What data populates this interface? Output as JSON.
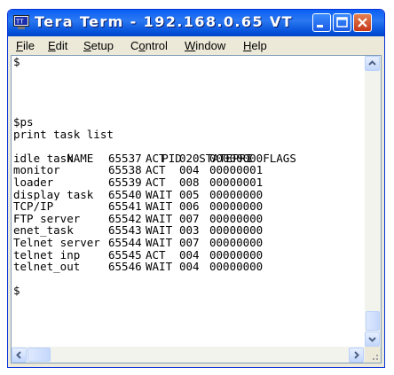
{
  "window": {
    "title": "Tera Term - 192.168.0.65 VT",
    "colors": {
      "titlebar": "#0a5ff5",
      "close_button": "#c6391a"
    }
  },
  "menu": [
    {
      "label": "File",
      "accel": "F"
    },
    {
      "label": "Edit",
      "accel": "E"
    },
    {
      "label": "Setup",
      "accel": "S"
    },
    {
      "label": "Control",
      "accel": "o"
    },
    {
      "label": "Window",
      "accel": "W"
    },
    {
      "label": "Help",
      "accel": "H"
    }
  ],
  "terminal": {
    "prompt_top": "$",
    "command": "$ps",
    "caption": "print task list",
    "headers": [
      "NAME",
      "PID",
      "STATE",
      "PRI",
      "FLAGS"
    ],
    "rows": [
      [
        "idle_task",
        "65537",
        "ACT",
        "020",
        "00000000"
      ],
      [
        "monitor",
        "65538",
        "ACT",
        "004",
        "00000001"
      ],
      [
        "loader",
        "65539",
        "ACT",
        "008",
        "00000001"
      ],
      [
        "display_task",
        "65540",
        "WAIT",
        "005",
        "00000000"
      ],
      [
        "TCP/IP",
        "65541",
        "WAIT",
        "006",
        "00000000"
      ],
      [
        "FTP server",
        "65542",
        "WAIT",
        "007",
        "00000000"
      ],
      [
        "enet_task",
        "65543",
        "WAIT",
        "003",
        "00000000"
      ],
      [
        "Telnet server",
        "65544",
        "WAIT",
        "007",
        "00000000"
      ],
      [
        "telnet_inp",
        "65545",
        "ACT",
        "004",
        "00000000"
      ],
      [
        "telnet_out",
        "65546",
        "WAIT",
        "004",
        "00000000"
      ]
    ],
    "prompt_bottom": "$"
  }
}
